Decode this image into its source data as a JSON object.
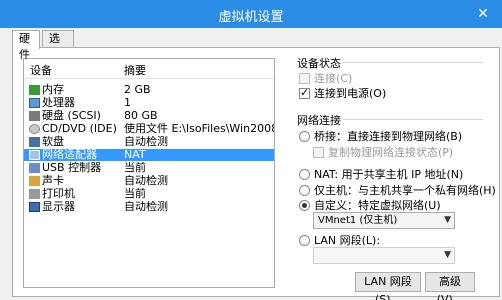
{
  "window": {
    "title": "虚拟机设置",
    "close_glyph": "✕"
  },
  "tabs": [
    {
      "label": "硬件"
    },
    {
      "label": "选项"
    }
  ],
  "list": {
    "col_device": "设备",
    "col_summary": "摘要",
    "rows": [
      {
        "name": "内存",
        "summary": "2 GB",
        "icon": "memory-icon"
      },
      {
        "name": "处理器",
        "summary": "1",
        "icon": "cpu-icon"
      },
      {
        "name": "硬盘 (SCSI)",
        "summary": "80 GB",
        "icon": "disk-icon"
      },
      {
        "name": "CD/DVD (IDE)",
        "summary": "使用文件 E:\\IsoFiles\\Win2008\\...",
        "icon": "cd-icon"
      },
      {
        "name": "软盘",
        "summary": "自动检测",
        "icon": "floppy-icon"
      },
      {
        "name": "网络适配器",
        "summary": "NAT",
        "icon": "network-icon",
        "selected": true
      },
      {
        "name": "USB 控制器",
        "summary": "当前",
        "icon": "usb-icon"
      },
      {
        "name": "声卡",
        "summary": "自动检测",
        "icon": "sound-icon"
      },
      {
        "name": "打印机",
        "summary": "当前",
        "icon": "printer-icon"
      },
      {
        "name": "显示器",
        "summary": "自动检测",
        "icon": "display-icon"
      }
    ]
  },
  "device_status": {
    "label": "设备状态",
    "connected": "连接(C)",
    "connect_on_power": "连接到电源(O)"
  },
  "network": {
    "label": "网络连接",
    "bridged": "桥接：直接连接到物理网络(B)",
    "replicate": "复制物理网络连接状态(P)",
    "nat": "NAT: 用于共享主机 IP 地址(N)",
    "host_only": "仅主机：与主机共享一个私有网络(H)",
    "custom": "自定义：特定虚拟网络(U)",
    "custom_value": "VMnet1 (仅主机)",
    "lan_segment": "LAN 网段(L):"
  },
  "buttons": {
    "lan_segments": "LAN 网段(S)...",
    "advanced": "高级(V)..."
  }
}
